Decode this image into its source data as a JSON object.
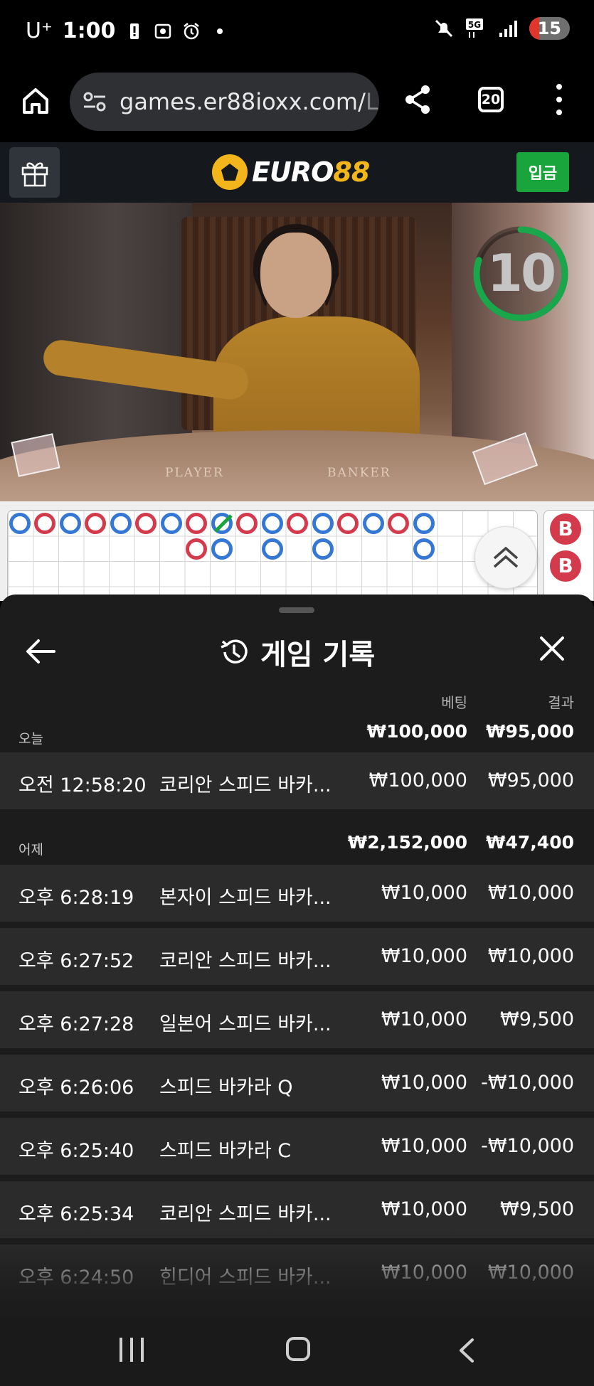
{
  "status_bar": {
    "carrier": "U⁺",
    "time": "1:00",
    "network": "5G",
    "battery": "15"
  },
  "browser": {
    "url_main": "games.er88ioxx.com/",
    "url_dim": "Lau",
    "tab_count": "20"
  },
  "site": {
    "logo_part1": "EURO",
    "logo_part2": "88",
    "deposit_label": "입금"
  },
  "video": {
    "countdown": "10",
    "countdown_fraction": 0.8,
    "table_label_player": "PLAYER",
    "table_label_banker": "BANKER"
  },
  "scoreboard": {
    "side_labels": [
      "B",
      "B"
    ]
  },
  "history": {
    "title": "게임 기록",
    "col_bet": "베팅",
    "col_result": "결과",
    "groups": [
      {
        "label": "오늘",
        "bet_total": "₩100,000",
        "result_total": "₩95,000",
        "records": [
          {
            "time": "오전 12:58:20",
            "game": "코리안 스피드 바카...",
            "bet": "₩100,000",
            "result": "₩95,000"
          }
        ]
      },
      {
        "label": "어제",
        "bet_total": "₩2,152,000",
        "result_total": "₩47,400",
        "records": [
          {
            "time": "오후 6:28:19",
            "game": "본자이 스피드 바카...",
            "bet": "₩10,000",
            "result": "₩10,000"
          },
          {
            "time": "오후 6:27:52",
            "game": "코리안 스피드 바카...",
            "bet": "₩10,000",
            "result": "₩10,000"
          },
          {
            "time": "오후 6:27:28",
            "game": "일본어 스피드 바카...",
            "bet": "₩10,000",
            "result": "₩9,500"
          },
          {
            "time": "오후 6:26:06",
            "game": "스피드 바카라 Q",
            "bet": "₩10,000",
            "result": "-₩10,000"
          },
          {
            "time": "오후 6:25:40",
            "game": "스피드 바카라 C",
            "bet": "₩10,000",
            "result": "-₩10,000"
          },
          {
            "time": "오후 6:25:34",
            "game": "코리안 스피드 바카...",
            "bet": "₩10,000",
            "result": "₩9,500"
          },
          {
            "time": "오후 6:24:50",
            "game": "힌디어 스피드 바카...",
            "bet": "₩10,000",
            "result": "₩10,000"
          }
        ]
      }
    ]
  },
  "colors": {
    "player_blue": "#3577d4",
    "banker_red": "#d33a4b",
    "tie_green": "#19a53b",
    "deposit_green": "#19a53b",
    "timer_green": "#1aa64a",
    "brand_gold": "#f2b51b"
  }
}
